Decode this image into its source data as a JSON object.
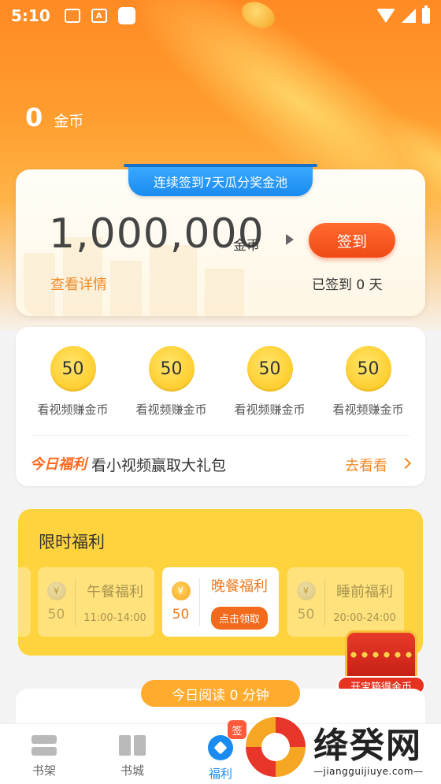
{
  "status_bar": {
    "time": "5:10",
    "notif_icon_text": "A"
  },
  "balance": {
    "amount": "0",
    "unit": "金币"
  },
  "checkin": {
    "banner": "连续签到7天瓜分奖金池",
    "pool_amount": "1,000,000",
    "pool_unit": "金币",
    "button": "签到",
    "detail_link": "查看详情",
    "signed_days": "已签到 0 天"
  },
  "video_tasks": {
    "items": [
      {
        "coins": "50",
        "label": "看视频赚金币"
      },
      {
        "coins": "50",
        "label": "看视频赚金币"
      },
      {
        "coins": "50",
        "label": "看视频赚金币"
      },
      {
        "coins": "50",
        "label": "看视频赚金币"
      }
    ],
    "today_logo": "今日福利",
    "today_text": "看小视频赢取大礼包",
    "go_look": "去看看"
  },
  "limited": {
    "title": "限时福利",
    "meals": [
      {
        "name": "午餐福利",
        "amount": "50",
        "time": "11:00-14:00",
        "coin_symbol": "¥"
      },
      {
        "name": "晚餐福利",
        "amount": "50",
        "action": "点击领取",
        "coin_symbol": "¥"
      },
      {
        "name": "睡前福利",
        "amount": "50",
        "time": "20:00-24:00",
        "coin_symbol": "¥"
      }
    ]
  },
  "chest": {
    "label": "开宝箱得金币"
  },
  "reading": {
    "pill": "今日阅读 0 分钟"
  },
  "nav": {
    "items": [
      {
        "label": "书架",
        "icon": "bookshelf-icon"
      },
      {
        "label": "书城",
        "icon": "book-icon"
      },
      {
        "label": "福利",
        "icon": "welfare-icon"
      }
    ],
    "badge": "签"
  },
  "watermark": {
    "name": "绛癸网",
    "url": "—jiangguijiuye.com—"
  },
  "colors": {
    "accent": "#1a8bf0",
    "orange": "#f04a17",
    "gold": "#ffd33d"
  }
}
